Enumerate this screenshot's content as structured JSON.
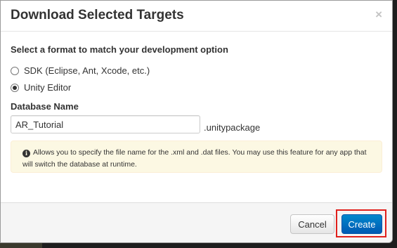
{
  "dialog": {
    "title": "Download Selected Targets",
    "close_symbol": "×"
  },
  "format_section": {
    "label": "Select a format to match your development option",
    "options": [
      {
        "label": "SDK (Eclipse, Ant, Xcode, etc.)",
        "checked": false
      },
      {
        "label": "Unity Editor",
        "checked": true
      }
    ]
  },
  "database": {
    "label": "Database Name",
    "value": "AR_Tutorial",
    "suffix": ".unitypackage"
  },
  "info": {
    "icon": "info-icon",
    "text": "Allows you to specify the file name for the .xml and .dat files. You may use this feature for any app that will switch the database at runtime."
  },
  "footer": {
    "cancel_label": "Cancel",
    "create_label": "Create"
  },
  "colors": {
    "primary": "#0074cc",
    "highlight": "#e0201c",
    "info_bg": "#fcf8e3"
  }
}
